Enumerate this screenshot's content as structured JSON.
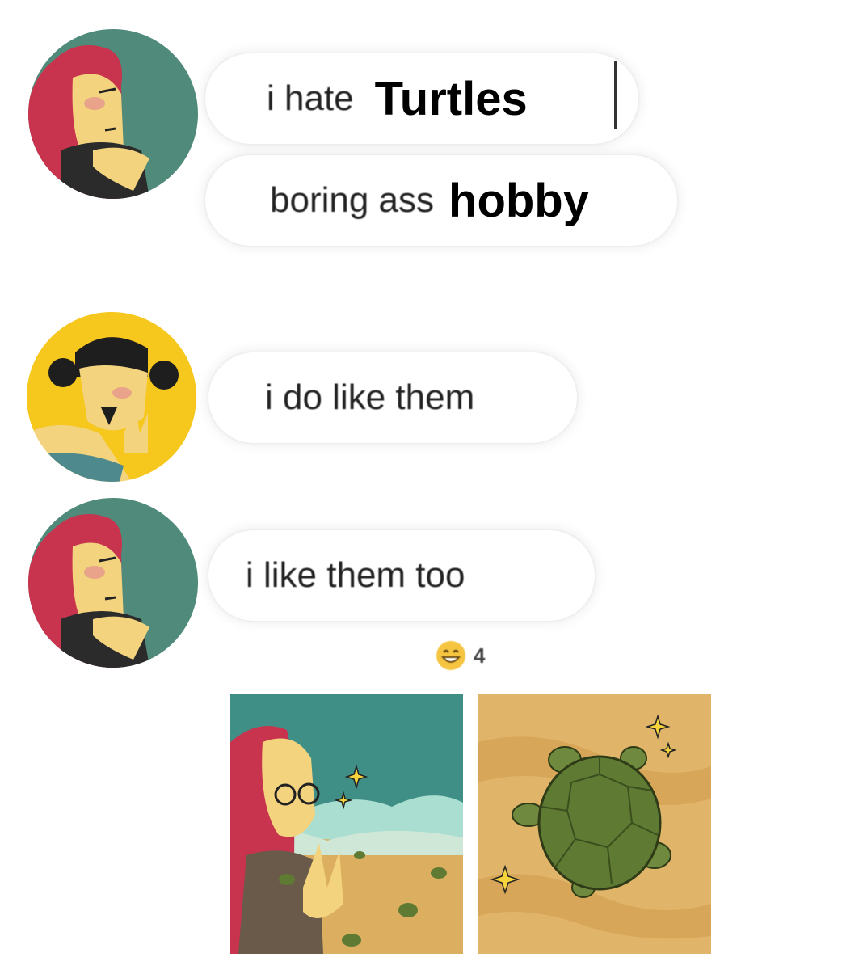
{
  "messages": [
    {
      "plain": "i hate",
      "emphasis": "Turtles"
    },
    {
      "plain": "boring ass",
      "emphasis": "hobby"
    },
    {
      "plain": "i do like them"
    },
    {
      "plain": "i like them too"
    }
  ],
  "reaction": {
    "icon": "grinning-emoji",
    "count": "4"
  },
  "colors": {
    "avatar_teal": "#4f8a7a",
    "avatar_yellow": "#f6c71c",
    "hair_red": "#c8344e",
    "skin": "#f3d37d",
    "sand": "#e0b56a",
    "turtle_green": "#5f7a33"
  }
}
